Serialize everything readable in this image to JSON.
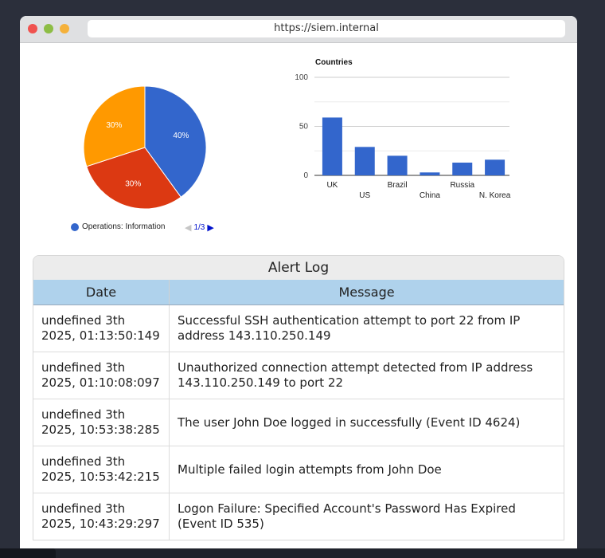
{
  "browser": {
    "url": "https://siem.internal"
  },
  "pie_chart": {
    "slices": [
      {
        "label": "40%",
        "value": 40,
        "color": "#3366cc"
      },
      {
        "label": "30%",
        "value": 30,
        "color": "#dc3912"
      },
      {
        "label": "30%",
        "value": 30,
        "color": "#ff9900"
      }
    ],
    "legend_label": "Operations: Information",
    "legend_color": "#3366cc",
    "pager_text": "1/3"
  },
  "chart_data": {
    "type": "bar",
    "title": "Countries",
    "categories": [
      "UK",
      "US",
      "Brazil",
      "China",
      "Russia",
      "N. Korea"
    ],
    "values": [
      59,
      29,
      20,
      3,
      13,
      16
    ],
    "ylim": [
      0,
      100
    ],
    "yticks": [
      0,
      50,
      100
    ],
    "color": "#3366cc"
  },
  "alert_log": {
    "title": "Alert Log",
    "columns": [
      "Date",
      "Message"
    ],
    "rows": [
      {
        "date": "undefined 3th 2025, 01:13:50:149",
        "message": "Successful SSH authentication attempt to port 22 from IP address 143.110.250.149"
      },
      {
        "date": "undefined 3th 2025, 01:10:08:097",
        "message": "Unauthorized connection attempt detected from IP address 143.110.250.149 to port 22"
      },
      {
        "date": "undefined 3th 2025, 10:53:38:285",
        "message": "The user John Doe logged in successfully (Event ID 4624)"
      },
      {
        "date": "undefined 3th 2025, 10:53:42:215",
        "message": "Multiple failed login attempts from John Doe"
      },
      {
        "date": "undefined 3th 2025, 10:43:29:297",
        "message": "Logon Failure: Specified Account's Password Has Expired (Event ID 535)"
      }
    ]
  }
}
